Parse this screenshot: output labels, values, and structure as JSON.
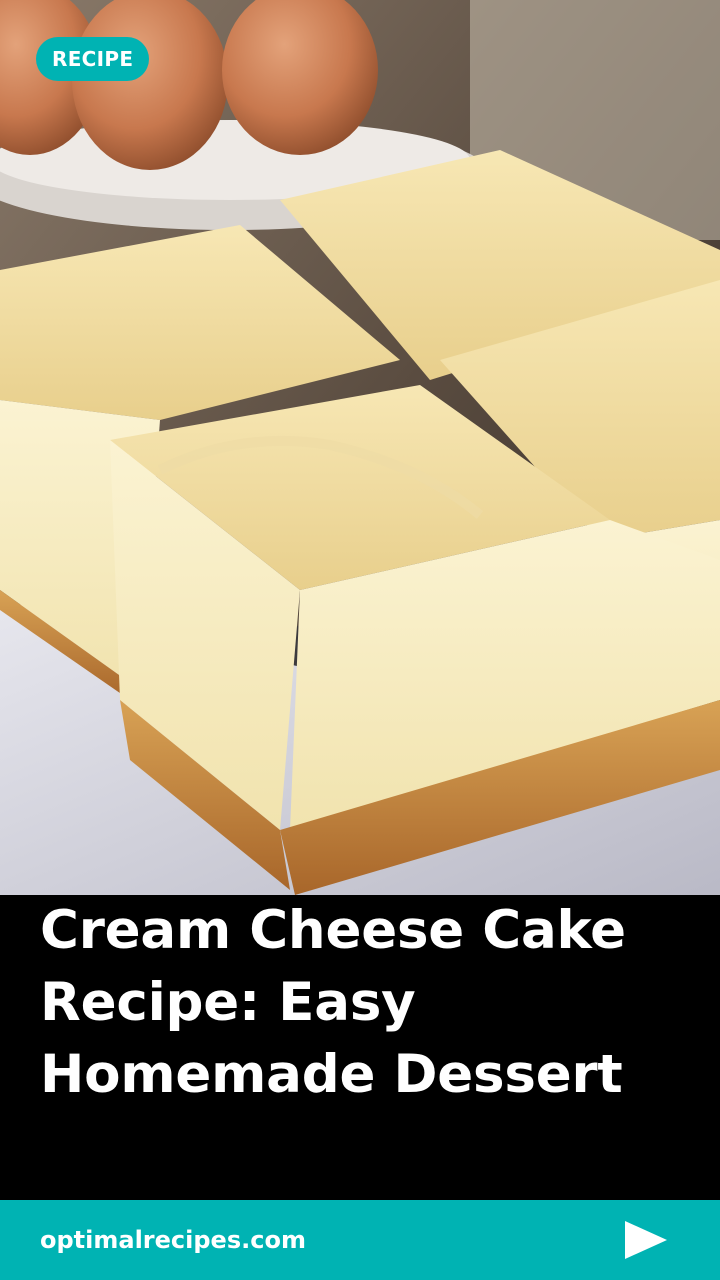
{
  "badge": {
    "label": "RECIPE"
  },
  "title": "Cream Cheese Cake Recipe: Easy Homemade Dessert",
  "footer": {
    "site": "optimalrecipes.com",
    "next_icon": "play-arrow-icon"
  },
  "colors": {
    "accent": "#00b3b3",
    "title_bg": "#000000",
    "text": "#ffffff"
  },
  "hero": {
    "subject": "cream-cheese-cake-bars-photo"
  }
}
